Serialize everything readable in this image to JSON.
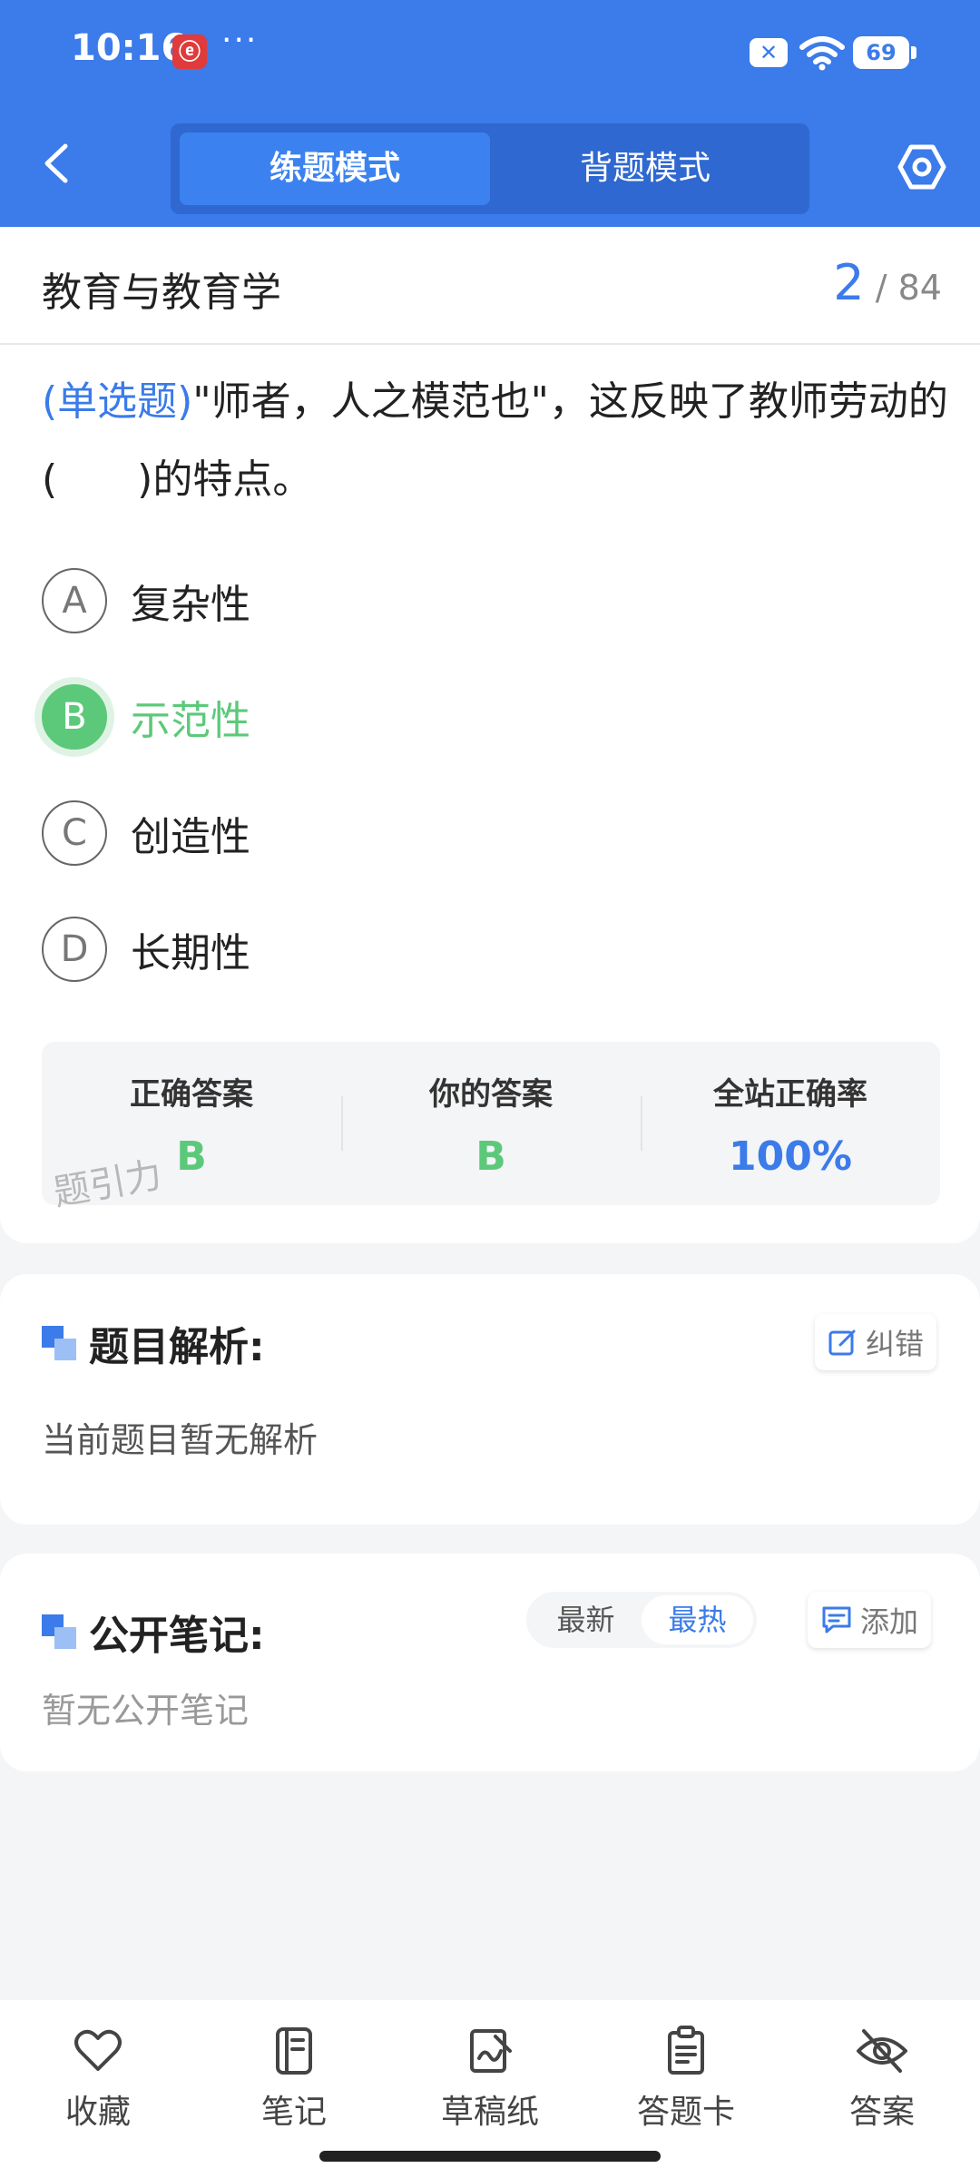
{
  "status_bar": {
    "time": "10:16",
    "app_badge": "ⓔ",
    "more": "···",
    "sim": "✕",
    "battery": "69"
  },
  "header": {
    "modes": [
      {
        "label": "练题模式",
        "active": true
      },
      {
        "label": "背题模式",
        "active": false
      }
    ]
  },
  "titlebar": {
    "subject": "教育与教育学",
    "current": "2",
    "total": "/ 84"
  },
  "question": {
    "type_label": "(单选题)",
    "text": "\"师者，人之模范也\"，这反映了教师劳动的(　　)的特点。",
    "options": [
      {
        "letter": "A",
        "text": "复杂性"
      },
      {
        "letter": "B",
        "text": "示范性",
        "state": "correct"
      },
      {
        "letter": "C",
        "text": "创造性"
      },
      {
        "letter": "D",
        "text": "长期性"
      }
    ]
  },
  "result": {
    "correct_label": "正确答案",
    "correct_value": "B",
    "yours_label": "你的答案",
    "yours_value": "B",
    "rate_label": "全站正确率",
    "rate_value": "100%",
    "watermark": "题引力"
  },
  "analysis": {
    "title": "题目解析:",
    "report_label": "纠错",
    "body": "当前题目暂无解析"
  },
  "notes": {
    "title": "公开笔记:",
    "sort_latest": "最新",
    "sort_hot": "最热",
    "add_label": "添加",
    "body": "暂无公开笔记"
  },
  "bottom_nav": [
    {
      "label": "收藏",
      "icon": "heart-icon"
    },
    {
      "label": "笔记",
      "icon": "notebook-icon"
    },
    {
      "label": "草稿纸",
      "icon": "draft-icon"
    },
    {
      "label": "答题卡",
      "icon": "answer-card-icon"
    },
    {
      "label": "答案",
      "icon": "eye-off-icon"
    }
  ],
  "colors": {
    "brand_blue": "#3b7bea",
    "correct_green": "#5cc97a"
  }
}
